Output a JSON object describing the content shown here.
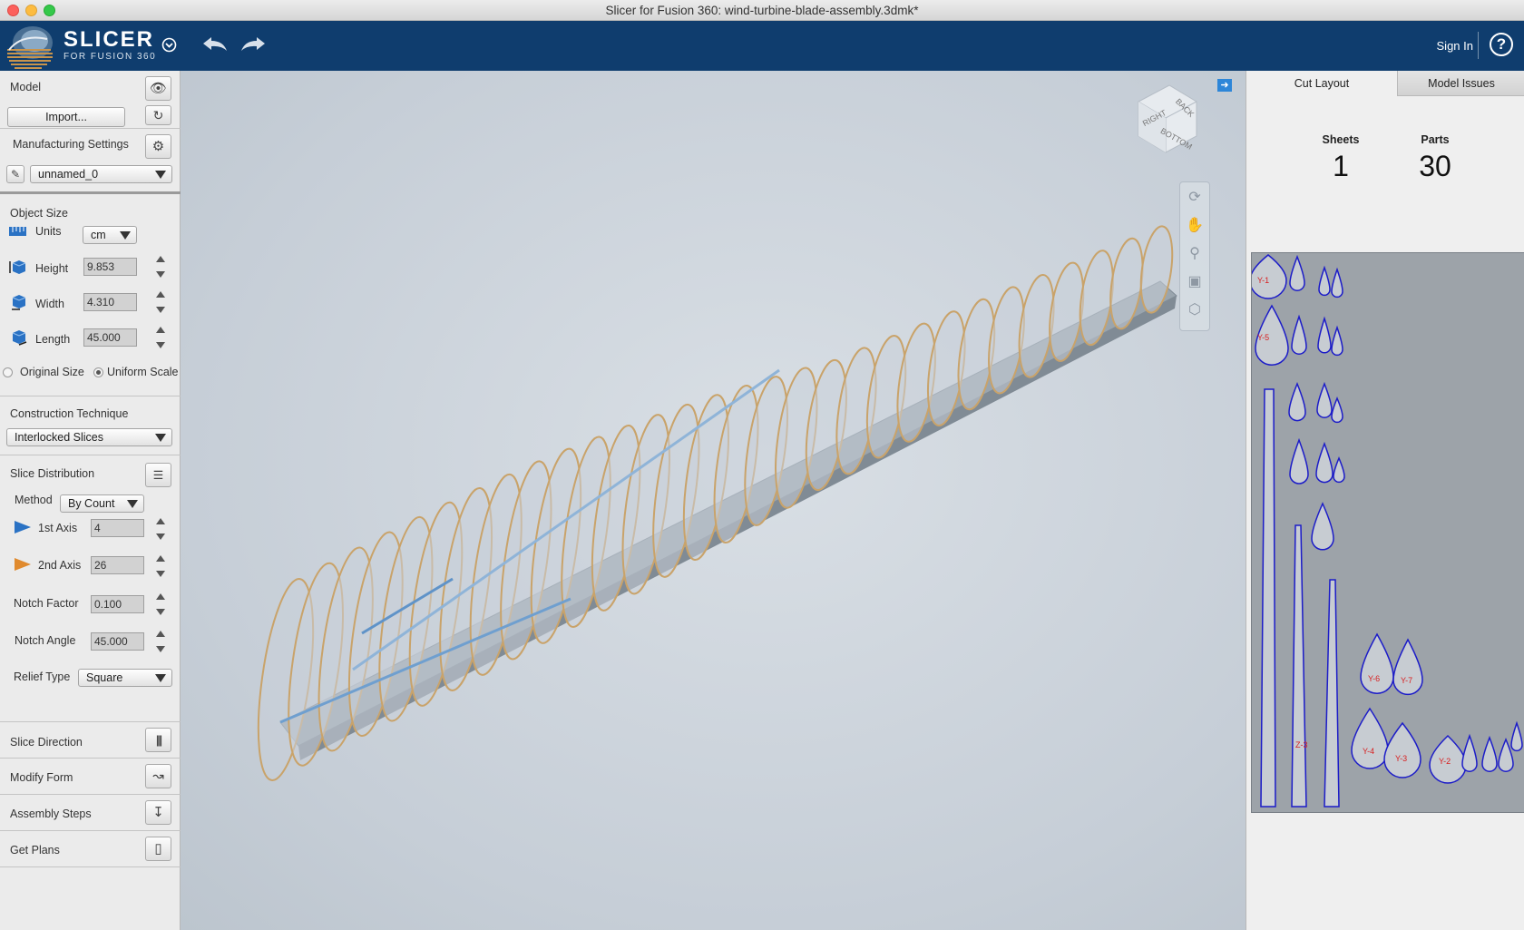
{
  "window": {
    "title": "Slicer for Fusion 360: wind-turbine-blade-assembly.3dmk*"
  },
  "header": {
    "brand_main": "SLICER",
    "brand_sub": "FOR FUSION 360",
    "sign_in": "Sign In",
    "help_glyph": "?",
    "accent_color": "#0f3d6e"
  },
  "left": {
    "model": {
      "label": "Model",
      "import_label": "Import..."
    },
    "manufacturing": {
      "label": "Manufacturing Settings",
      "preset": "unnamed_0"
    },
    "object_size": {
      "label": "Object Size",
      "units_label": "Units",
      "units_value": "cm",
      "height_label": "Height",
      "height_value": "9.853",
      "width_label": "Width",
      "width_value": "4.310",
      "length_label": "Length",
      "length_value": "45.000",
      "original_size": "Original Size",
      "uniform_scale": "Uniform Scale"
    },
    "construction": {
      "label": "Construction Technique",
      "value": "Interlocked Slices"
    },
    "distribution": {
      "label": "Slice Distribution",
      "method_label": "Method",
      "method_value": "By Count",
      "axis1_label": "1st Axis",
      "axis1_value": "4",
      "axis2_label": "2nd Axis",
      "axis2_value": "26",
      "notch_factor_label": "Notch Factor",
      "notch_factor_value": "0.100",
      "notch_angle_label": "Notch Angle",
      "notch_angle_value": "45.000",
      "relief_label": "Relief Type",
      "relief_value": "Square"
    },
    "slice_direction": "Slice Direction",
    "modify_form": "Modify Form",
    "assembly_steps": "Assembly Steps",
    "get_plans": "Get Plans"
  },
  "viewcube": {
    "right": "RIGHT",
    "back": "BACK",
    "bottom": "BOTTOM"
  },
  "right": {
    "tab_cut_layout": "Cut Layout",
    "tab_model_issues": "Model Issues",
    "sheets_label": "Sheets",
    "sheets_value": "1",
    "parts_label": "Parts",
    "parts_value": "30",
    "part_labels": [
      "Y-1",
      "Y-5",
      "Y-6",
      "Y-7",
      "Y-4",
      "Y-3",
      "Y-2",
      "Z-3"
    ]
  }
}
